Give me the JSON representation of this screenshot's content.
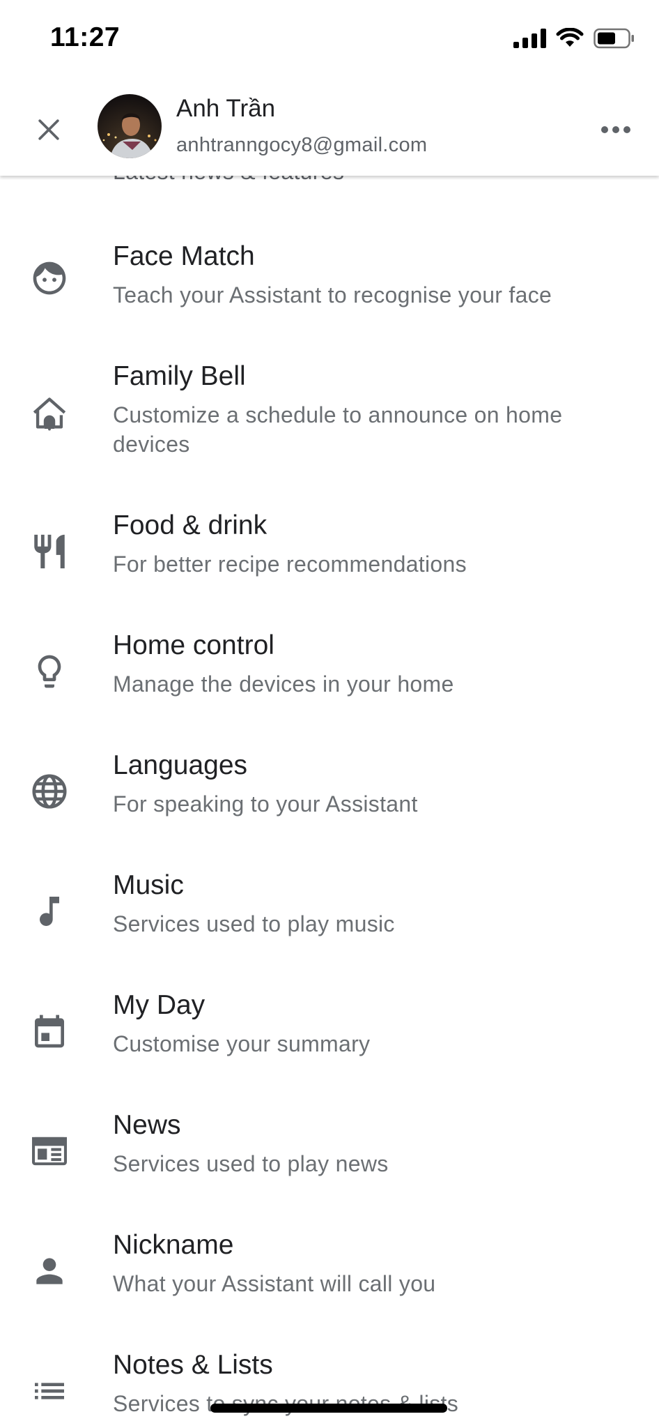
{
  "status_bar": {
    "time": "11:27",
    "icons": [
      "cellular-signal-icon",
      "wifi-icon",
      "battery-icon"
    ]
  },
  "header": {
    "close_icon": "close-icon",
    "name": "Anh Trần",
    "email": "anhtranngocy8@gmail.com",
    "more_icon": "more-horizontal-icon"
  },
  "list": {
    "partial_subtitle": "Latest news & features",
    "items": [
      {
        "icon": "face-icon",
        "title": "Face Match",
        "subtitle": "Teach your Assistant to recognise your face"
      },
      {
        "icon": "home-bell-icon",
        "title": "Family Bell",
        "subtitle": "Customize a schedule to announce on home devices"
      },
      {
        "icon": "restaurant-icon",
        "title": "Food & drink",
        "subtitle": "For better recipe recommendations"
      },
      {
        "icon": "lightbulb-icon",
        "title": "Home control",
        "subtitle": "Manage the devices in your home"
      },
      {
        "icon": "globe-icon",
        "title": "Languages",
        "subtitle": "For speaking to your Assistant"
      },
      {
        "icon": "music-note-icon",
        "title": "Music",
        "subtitle": "Services used to play music"
      },
      {
        "icon": "calendar-icon",
        "title": "My Day",
        "subtitle": "Customise your summary"
      },
      {
        "icon": "newspaper-icon",
        "title": "News",
        "subtitle": "Services used to play news"
      },
      {
        "icon": "person-icon",
        "title": "Nickname",
        "subtitle": "What your Assistant will call you"
      },
      {
        "icon": "list-icon",
        "title": "Notes & Lists",
        "subtitle": "Services to sync your notes & lists"
      }
    ]
  },
  "colors": {
    "title_text": "#202124",
    "subtitle_text": "#6b6f73",
    "icon": "#5f6368",
    "background": "#ffffff"
  }
}
